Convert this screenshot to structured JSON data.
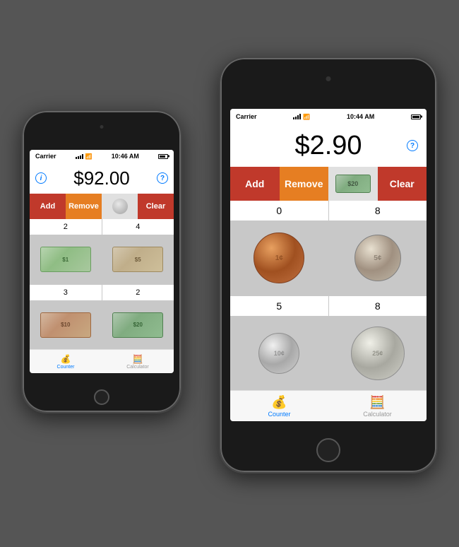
{
  "scene": {
    "background": "#555"
  },
  "phone_small": {
    "status": {
      "carrier": "Carrier",
      "wifi": "▾",
      "time": "10:46 AM",
      "battery_pct": 85
    },
    "amount": "$92.00",
    "toolbar": {
      "add_label": "Add",
      "remove_label": "Remove",
      "clear_label": "Clear"
    },
    "grid": {
      "counts": [
        "2",
        "4",
        "3",
        "2"
      ],
      "items": [
        "1-dollar-bill",
        "5-dollar-bill",
        "10-dollar-bill",
        "20-dollar-bill"
      ]
    },
    "tabs": {
      "counter_label": "Counter",
      "calculator_label": "Calculator"
    }
  },
  "phone_large": {
    "status": {
      "carrier": "Carrier",
      "wifi": "▾",
      "time": "10:44 AM",
      "battery_pct": 100
    },
    "amount": "$2.90",
    "toolbar": {
      "add_label": "Add",
      "remove_label": "Remove",
      "clear_label": "Clear"
    },
    "grid": {
      "counts": [
        "0",
        "8",
        "5",
        "8"
      ],
      "items": [
        "penny",
        "nickel",
        "dime",
        "quarter"
      ]
    },
    "tabs": {
      "counter_label": "Counter",
      "calculator_label": "Calculator"
    }
  }
}
